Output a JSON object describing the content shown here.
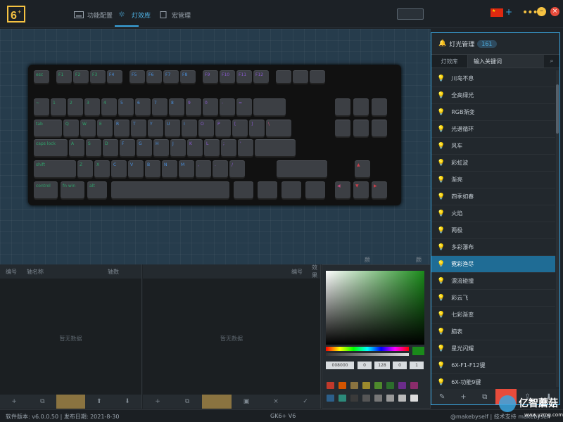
{
  "nav": {
    "tabs": [
      {
        "label": "功能配置"
      },
      {
        "label": "灯效库"
      },
      {
        "label": "宏管理"
      }
    ]
  },
  "window": {
    "add_label": "+",
    "menu_label": "•••",
    "min_label": "–",
    "close_label": "×"
  },
  "keyboard": {
    "rows": [
      [
        "esc",
        "F1",
        "F2",
        "F3",
        "F4",
        "F5",
        "F6",
        "F7",
        "F8",
        "F9",
        "F10",
        "F11",
        "F12",
        "",
        "",
        ""
      ],
      [
        "~",
        "1",
        "2",
        "3",
        "4",
        "5",
        "6",
        "7",
        "8",
        "9",
        "0",
        "-",
        "=",
        "",
        "",
        "",
        ""
      ],
      [
        "tab",
        "Q",
        "W",
        "E",
        "R",
        "T",
        "Y",
        "U",
        "I",
        "O",
        "P",
        "[",
        "]",
        "\\",
        "",
        "",
        ""
      ],
      [
        "caps lock",
        "A",
        "S",
        "D",
        "F",
        "G",
        "H",
        "J",
        "K",
        "L",
        ";",
        "'",
        ""
      ],
      [
        "shift",
        "Z",
        "X",
        "C",
        "V",
        "B",
        "N",
        "M",
        ",",
        ".",
        "/",
        "",
        "▲"
      ],
      [
        "control",
        "fn win",
        "alt",
        "",
        "",
        "",
        "",
        "",
        "◀",
        "▼",
        "▶"
      ]
    ]
  },
  "bottom_panels": {
    "left": {
      "headers": [
        "编号",
        "轴名称",
        "轴数"
      ],
      "empty": "暂无数据",
      "foot": [
        "+",
        "⧉",
        "",
        "⬆",
        "⬇"
      ]
    },
    "middle": {
      "headers": [
        "编号",
        "效果",
        "颜色配置",
        "颜色参数"
      ],
      "empty": "暂无数据",
      "foot": [
        "+",
        "⧉",
        "",
        "▣",
        "×",
        "✓"
      ]
    }
  },
  "color_picker": {
    "hex": "008000",
    "r": "0",
    "g": "128",
    "b": "0",
    "a": "1",
    "swatches": [
      "#c0392b",
      "#d35400",
      "#8a7340",
      "#9c8a2c",
      "#4f8a2c",
      "#2c6e2c",
      "#6b2c8a",
      "#8a2c6b",
      "#2c5f8a",
      "#2c8a7a",
      "#3a3a3a",
      "#555555",
      "#777777",
      "#999999",
      "#bbbbbb",
      "#dddddd"
    ]
  },
  "effects_panel": {
    "title": "灯光管理",
    "count": "161",
    "tab": "灯效库",
    "search_placeholder": "输入关键词",
    "search_icon": "⌕",
    "items": [
      "川岛不息",
      "全高绿光",
      "RGB渐变",
      "光谱循环",
      "风车",
      "彩虹波",
      "渐亮",
      "四季如春",
      "火焰",
      "两极",
      "多彩瀑布",
      "霓彩渔尽",
      "漂流碰撞",
      "彩云飞",
      "七彩渐变",
      "脑表",
      "星光闪耀",
      "6X-F1-F12键",
      "6X-功能9键"
    ],
    "selected_index": 11,
    "foot": [
      "✎",
      "+",
      "⧉",
      "",
      "⇪",
      "⬇"
    ]
  },
  "status": {
    "version": "软件版本: v6.0.0.50 | 发布日期: 2021-8-30",
    "device": "GK6+ V6",
    "support": "@makebyself | 技术支持 makebyself"
  },
  "watermark": {
    "brand": "亿智蘑菇",
    "url": "www.yzmg.com"
  },
  "colors": {
    "accent": "#3aa6e0",
    "selected": "#1f6c95",
    "gold": "#8a7340"
  }
}
